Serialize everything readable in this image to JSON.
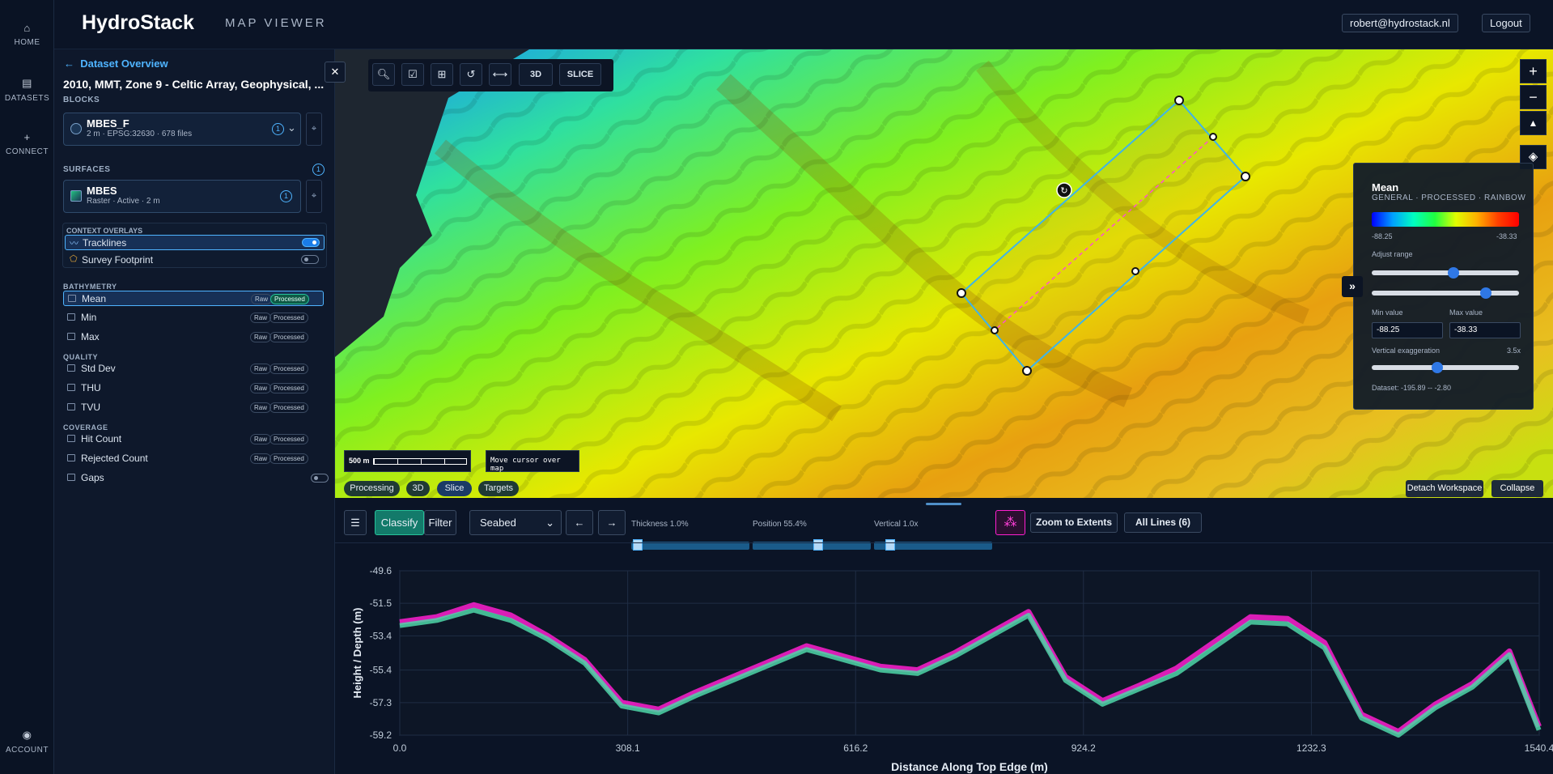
{
  "rail": {
    "home": "HOME",
    "datasets": "DATASETS",
    "connect": "CONNECT",
    "account": "ACCOUNT"
  },
  "header": {
    "brand": "HydroStack",
    "subtitle": "MAP VIEWER",
    "user": "robert@hydrostack.nl",
    "logout": "Logout"
  },
  "sidebar": {
    "back": "Dataset Overview",
    "dataset_title": "2010, MMT, Zone 9 - Celtic Array, Geophysical, ...",
    "blocks_label": "BLOCKS",
    "block": {
      "name": "MBES_F",
      "meta": "2 m · EPSG:32630 · 678 files",
      "count": "1"
    },
    "surfaces_label": "SURFACES",
    "surfaces_count": "1",
    "surface": {
      "name": "MBES",
      "meta": "Raster · Active · 2 m",
      "count": "1"
    },
    "overlays_label": "CONTEXT OVERLAYS",
    "overlays": [
      {
        "label": "Tracklines",
        "on": true
      },
      {
        "label": "Survey Footprint",
        "on": false
      }
    ],
    "groups": [
      {
        "label": "BATHYMETRY",
        "items": [
          "Mean",
          "Min",
          "Max"
        ]
      },
      {
        "label": "QUALITY",
        "items": [
          "Std Dev",
          "THU",
          "TVU"
        ]
      },
      {
        "label": "COVERAGE",
        "items": [
          "Hit Count",
          "Rejected Count",
          "Gaps"
        ]
      }
    ],
    "raw": "Raw",
    "processed": "Processed"
  },
  "map": {
    "toolbar": {
      "btn3d": "3D",
      "slice": "SLICE"
    },
    "scale": "500 m",
    "cursor": "Move cursor over map",
    "tabs": [
      "Processing",
      "3D",
      "Slice",
      "Targets"
    ],
    "detach": "Detach Workspace",
    "collapse": "Collapse",
    "expand": "»"
  },
  "panel": {
    "title": "Mean",
    "sub": "GENERAL · PROCESSED · RAINBOW",
    "cmin": "-88.25",
    "cmax": "-38.33",
    "adjust": "Adjust range",
    "min_label": "Min value",
    "max_label": "Max value",
    "min_value": "-88.25",
    "max_value": "-38.33",
    "vex_label": "Vertical exaggeration",
    "vex": "3.5x",
    "dataset": "Dataset: -195.89 -- -2.80",
    "range_low": 0.56,
    "range_high": 0.8,
    "vex_pos": 0.44
  },
  "profile_controls": {
    "classify": "Classify",
    "filter": "Filter",
    "seabed": "Seabed",
    "thickness": "Thickness 1.0%",
    "position": "Position 55.4%",
    "vertical": "Vertical 1.0x",
    "zoom": "Zoom to Extents",
    "lines": "All Lines (6)"
  },
  "colors": {
    "accent": "#4fb4ff",
    "teal": "#25c29a",
    "magenta": "#ff1fd0"
  },
  "chart_data": {
    "type": "line",
    "xlabel": "Distance Along Top Edge (m)",
    "ylabel": "Height / Depth (m)",
    "xlim": [
      0,
      1540.4
    ],
    "ylim": [
      -59.2,
      -49.6
    ],
    "xticks": [
      "0.0",
      "308.1",
      "616.2",
      "924.2",
      "1232.3",
      "1540.4"
    ],
    "yticks": [
      "-49.6",
      "-51.5",
      "-53.4",
      "-55.4",
      "-57.3",
      "-59.2"
    ],
    "x": [
      0,
      50,
      100,
      150,
      200,
      250,
      300,
      350,
      400,
      450,
      500,
      550,
      600,
      650,
      700,
      750,
      800,
      850,
      900,
      950,
      1000,
      1050,
      1100,
      1150,
      1200,
      1250,
      1300,
      1350,
      1400,
      1450,
      1500,
      1540
    ],
    "series": [
      {
        "values": [
          -52.6,
          -52.3,
          -51.6,
          -52.2,
          -53.4,
          -54.8,
          -57.3,
          -57.7,
          -56.7,
          -55.8,
          -54.9,
          -54.0,
          -54.6,
          -55.2,
          -55.4,
          -54.4,
          -53.2,
          -52.0,
          -55.8,
          -57.2,
          -56.3,
          -55.3,
          -53.8,
          -52.3,
          -52.4,
          -53.8,
          -58.0,
          -59.0,
          -57.4,
          -56.2,
          -54.3,
          -58.7
        ]
      },
      {
        "values": [
          -52.8,
          -52.5,
          -51.9,
          -52.5,
          -53.6,
          -55.0,
          -57.5,
          -57.9,
          -56.9,
          -56.0,
          -55.1,
          -54.2,
          -54.8,
          -55.4,
          -55.6,
          -54.6,
          -53.4,
          -52.2,
          -56.0,
          -57.4,
          -56.5,
          -55.6,
          -54.1,
          -52.6,
          -52.7,
          -54.1,
          -58.2,
          -59.2,
          -57.6,
          -56.4,
          -54.5,
          -58.9
        ]
      }
    ]
  }
}
